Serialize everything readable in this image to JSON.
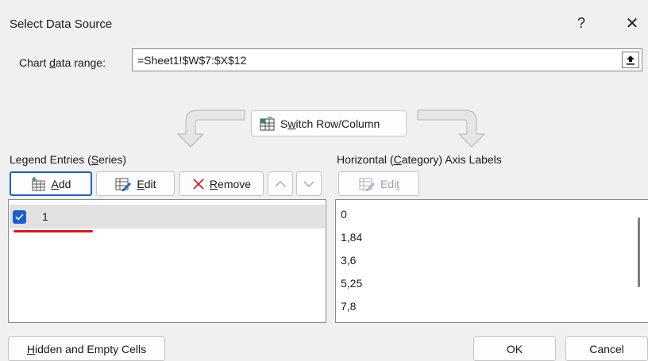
{
  "window": {
    "title": "Select Data Source",
    "help_label": "?",
    "close_label": "✕"
  },
  "range": {
    "label_prefix": "Chart ",
    "label_accel": "d",
    "label_suffix": "ata range:",
    "value": "=Sheet1!$W$7:$X$12"
  },
  "switch": {
    "label_prefix": "S",
    "label_accel": "w",
    "label_suffix": "itch Row/Column"
  },
  "legend": {
    "label_prefix": "Legend Entries (",
    "label_accel": "S",
    "label_suffix": "eries)",
    "add_accel": "A",
    "add_rest": "dd",
    "edit_accel": "E",
    "edit_rest": "dit",
    "remove_accel": "R",
    "remove_rest": "emove",
    "series": [
      {
        "name": "1",
        "checked": true
      }
    ]
  },
  "axis": {
    "label_prefix": "Horizontal (",
    "label_accel": "C",
    "label_suffix": "ategory) Axis Labels",
    "edit_prefix": "Edi",
    "edit_accel": "t",
    "items": [
      "0",
      "1,84",
      "3,6",
      "5,25",
      "7,8"
    ]
  },
  "footer": {
    "hidden_accel": "H",
    "hidden_rest": "idden and Empty Cells",
    "ok_label": "OK",
    "cancel_label": "Cancel"
  },
  "colors": {
    "accent": "#1a5fd0",
    "annotation": "#e01818"
  }
}
